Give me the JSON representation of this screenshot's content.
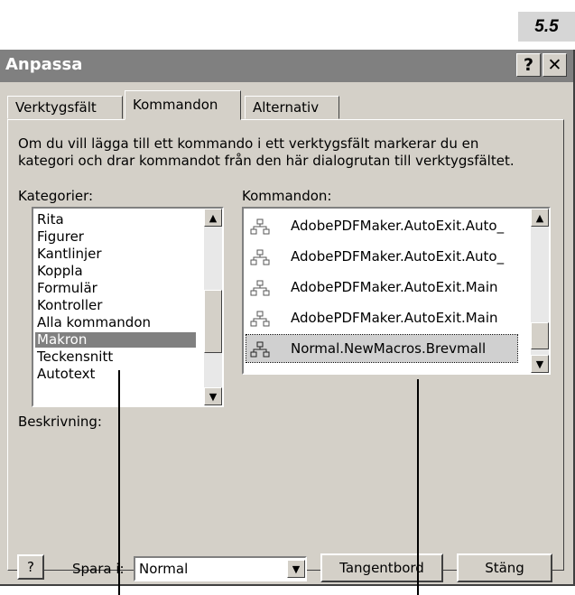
{
  "badge": "5.5",
  "window": {
    "title": "Anpassa",
    "help_button": "?",
    "close_button": "✕"
  },
  "tabs": [
    {
      "label": "Verktygsfält",
      "active": false
    },
    {
      "label": "Kommandon",
      "active": true
    },
    {
      "label": "Alternativ",
      "active": false
    }
  ],
  "description_line1": "Om du vill lägga till ett kommando i ett verktygsfält markerar du en",
  "description_line2": "kategori och drar kommandot från den här dialogrutan till verktygsfältet.",
  "categories": {
    "label": "Kategorier:",
    "items": [
      "Rita",
      "Figurer",
      "Kantlinjer",
      "Koppla",
      "Formulär",
      "Kontroller",
      "Alla kommandon",
      "Makron",
      "Teckensnitt",
      "Autotext"
    ],
    "selected": "Makron"
  },
  "commands": {
    "label": "Kommandon:",
    "items": [
      "AdobePDFMaker.AutoExit.Auto_",
      "AdobePDFMaker.AutoExit.Auto_",
      "AdobePDFMaker.AutoExit.Main",
      "AdobePDFMaker.AutoExit.Main",
      "Normal.NewMacros.Brevmall"
    ],
    "selected": "Normal.NewMacros.Brevmall"
  },
  "description_label": "Beskrivning:",
  "footer": {
    "help_icon": "?",
    "save_in_label": "Spara i:",
    "save_in_value": "Normal",
    "keyboard_button": "Tangentbord",
    "close_button": "Stäng"
  },
  "colors": {
    "dialog_bg": "#d4d0c8",
    "titlebar_bg": "#808080",
    "selection_bg": "#808080"
  }
}
